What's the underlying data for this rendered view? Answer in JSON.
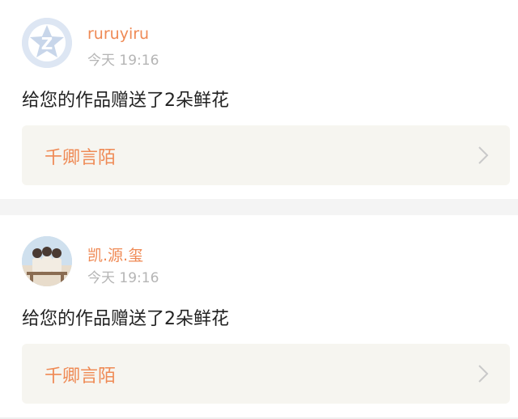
{
  "notifications": [
    {
      "username": "ruruyiru",
      "time": "今天 19:16",
      "message": "给您的作品赠送了2朵鲜花",
      "work_title": "千卿言陌",
      "avatar_icon": "default-avatar-icon",
      "chevron_icon": "chevron-right-icon"
    },
    {
      "username": "凯.源.玺",
      "time": "今天 19:16",
      "message": "给您的作品赠送了2朵鲜花",
      "work_title": "千卿言陌",
      "avatar_icon": "user-photo-avatar",
      "chevron_icon": "chevron-right-icon"
    }
  ],
  "colors": {
    "accent": "#ef8a55",
    "muted": "#b5b5b5",
    "text": "#222222",
    "page_bg": "#f4f4f4",
    "link_bg": "#f6f5f0"
  }
}
